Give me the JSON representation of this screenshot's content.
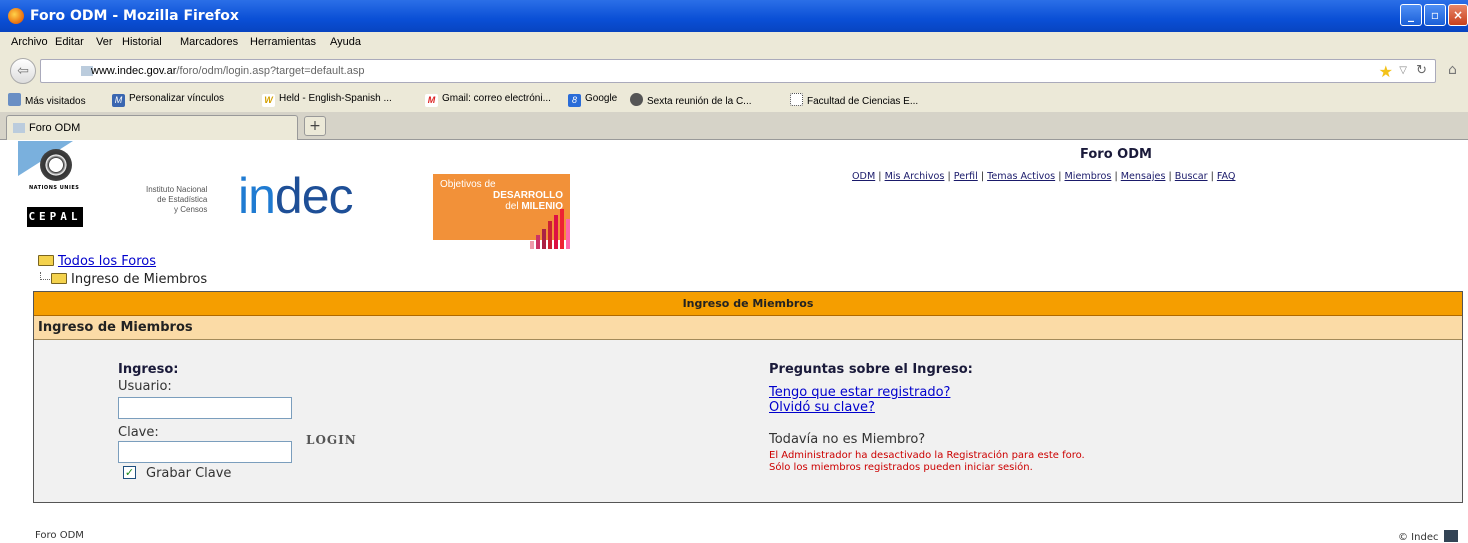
{
  "window": {
    "title": "Foro ODM - Mozilla Firefox"
  },
  "menu": [
    "Archivo",
    "Editar",
    "Ver",
    "Historial",
    "Marcadores",
    "Herramientas",
    "Ayuda"
  ],
  "address": {
    "host": "www.indec.gov.ar",
    "path": "/foro/odm/login.asp?target=default.asp"
  },
  "bookmarks": [
    "Más visitados",
    "Personalizar vínculos",
    "Held - English-Spanish ...",
    "Gmail: correo electróni...",
    "Google",
    "Sexta reunión de la C...",
    "Facultad de Ciencias E..."
  ],
  "tab": {
    "label": "Foro ODM",
    "new_tab": "+"
  },
  "header": {
    "un_text": "NATIONS UNIES",
    "cepal": "CEPAL",
    "indec_small": [
      "Instituto Nacional",
      "de Estadística",
      "y Censos"
    ],
    "indec_part1": "in",
    "indec_part2": "dec",
    "odm_line1": "Objetivos de",
    "odm_line2": "DESARROLLO",
    "odm_line3a": "del ",
    "odm_line3b": "MILENIO",
    "site_title": "Foro ODM",
    "nav_links": [
      "ODM",
      "Mis Archivos",
      "Perfil",
      "Temas Activos",
      "Miembros",
      "Mensajes",
      "Buscar",
      "FAQ"
    ]
  },
  "breadcrumb": {
    "root": "Todos los Foros",
    "current": "Ingreso de Miembros"
  },
  "login": {
    "table_title": "Ingreso de Miembros",
    "section_title": "Ingreso de Miembros",
    "heading": "Ingreso:",
    "user_label": "Usuario:",
    "user_value": "",
    "pass_label": "Clave:",
    "pass_value": "",
    "login_button": "LOGIN",
    "remember_label": "Grabar Clave",
    "remember_checked": true
  },
  "questions": {
    "heading": "Preguntas sobre el Ingreso:",
    "link_registered": "Tengo que estar registrado?",
    "link_forgot": "Olvidó su clave?",
    "not_member": "Todavía no es Miembro?",
    "error1": "El Administrador ha desactivado la Registración para este foro.",
    "error2": "Sólo los miembros registrados pueden iniciar sesión."
  },
  "footer": {
    "left": "Foro ODM",
    "right": "© Indec"
  },
  "colors": {
    "header_orange": "#f59e00",
    "sub_header": "#fbdba6",
    "error_red": "#cc0000",
    "link_blue": "#0000cc"
  }
}
